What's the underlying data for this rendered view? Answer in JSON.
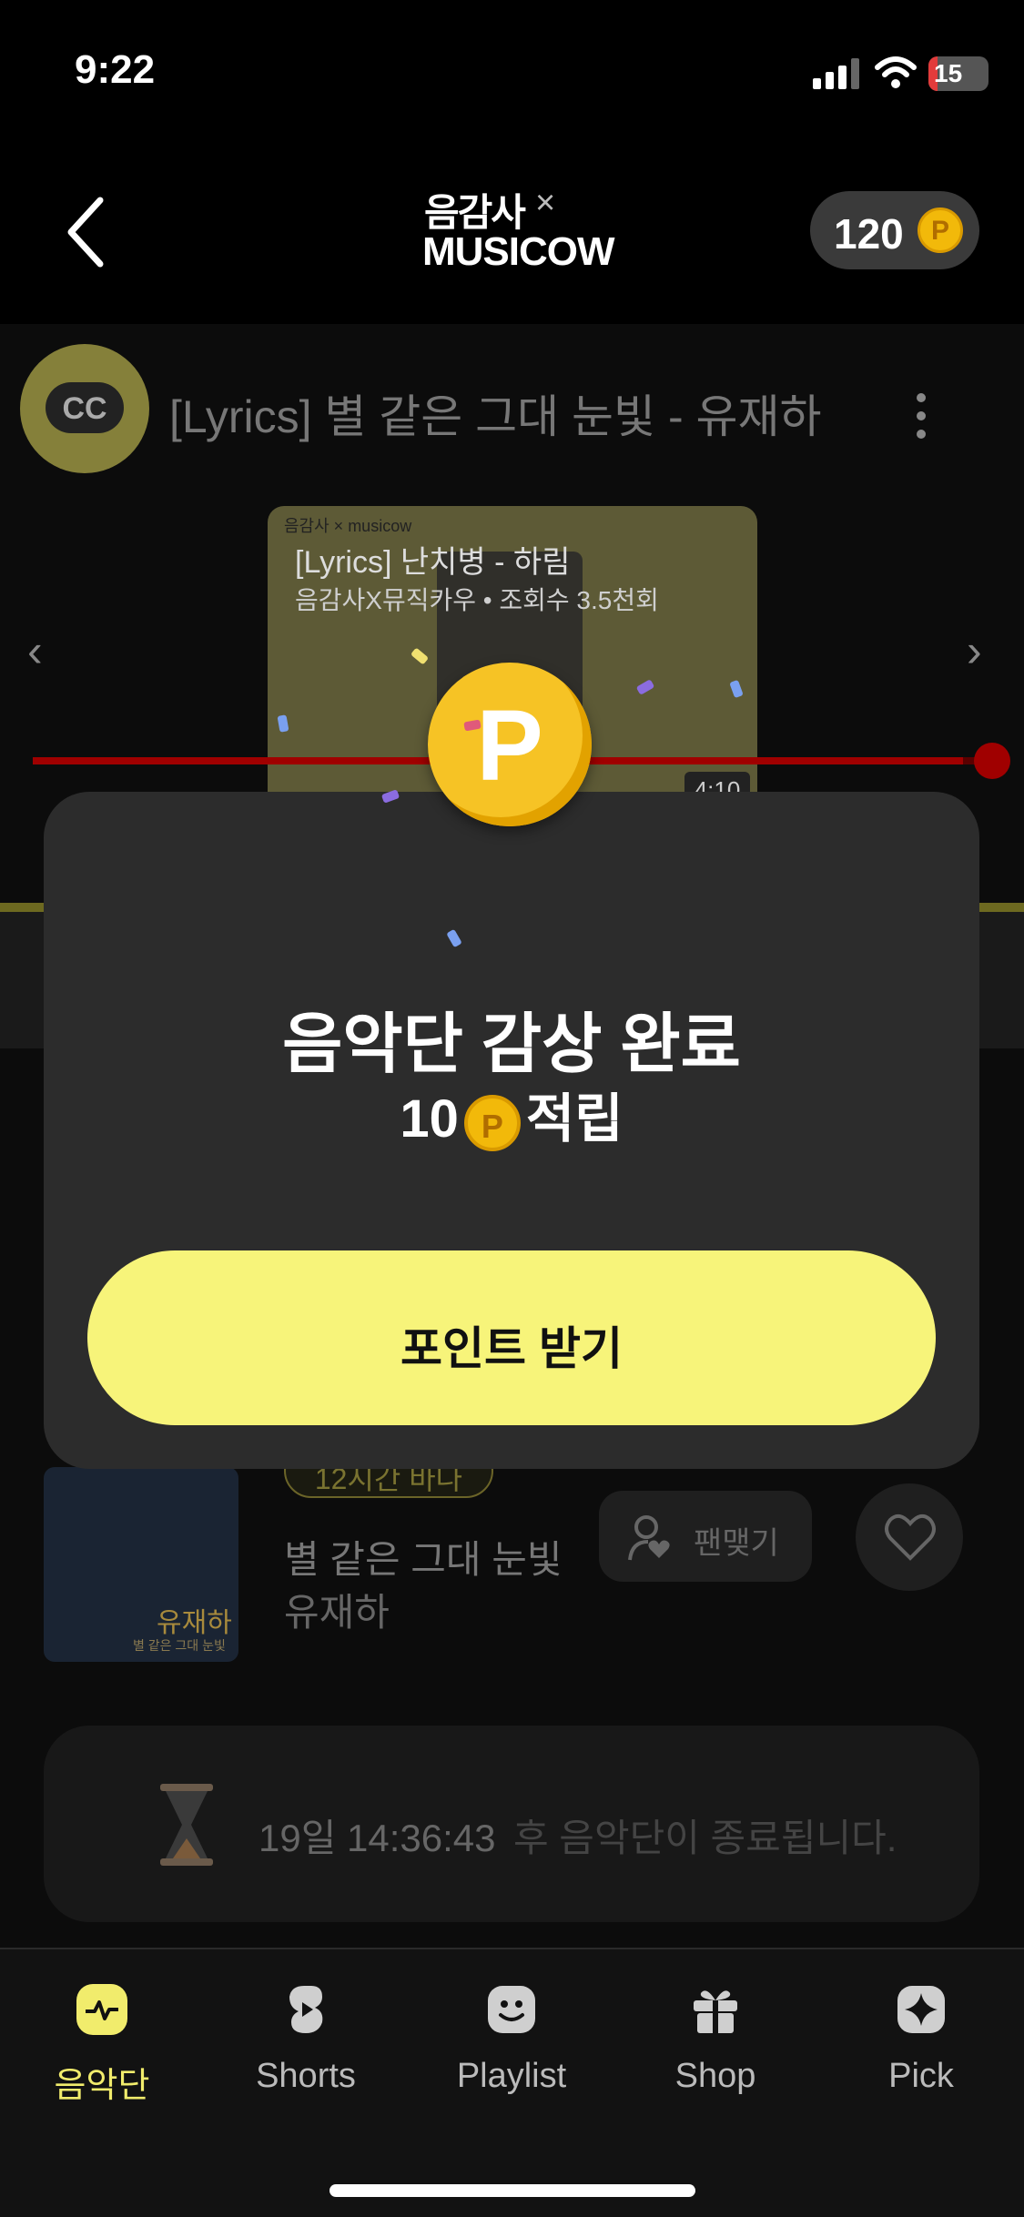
{
  "status_bar": {
    "time": "9:22",
    "battery": "15",
    "battery_level": 0.15
  },
  "header": {
    "logo_top": "음감사",
    "logo_x": "×",
    "logo_bottom": "MUSICOW",
    "points": "120",
    "point_symbol": "P"
  },
  "video": {
    "channel_avatar": "CC",
    "title": "[Lyrics] 별 같은 그대 눈빛 - 유재하",
    "next_card": {
      "title": "[Lyrics] 난치병 - 하림",
      "subtitle": "음감사X뮤직카우 • 조회수 3.5천회",
      "duration": "4:10",
      "card_logo": "음감사 × musicow"
    },
    "progress": 0.97
  },
  "track": {
    "tag": "12시간 바나",
    "album_text": "유재하",
    "album_subtext": "별 같은 그대 눈빛",
    "song": "별 같은 그대 눈빛",
    "artist": "유재하",
    "fan_button": "팬맺기"
  },
  "timer": {
    "time": "19일 14:36:43",
    "text": "후 음악단이 종료됩니다."
  },
  "modal": {
    "title": "음악단 감상 완료",
    "reward_amount": "10",
    "reward_symbol": "P",
    "reward_suffix": "적립",
    "button": "포인트 받기"
  },
  "tabs": [
    {
      "label": "음악단",
      "icon": "pulse-icon",
      "active": true
    },
    {
      "label": "Shorts",
      "icon": "shorts-icon",
      "active": false
    },
    {
      "label": "Playlist",
      "icon": "smile-icon",
      "active": false
    },
    {
      "label": "Shop",
      "icon": "gift-icon",
      "active": false
    },
    {
      "label": "Pick",
      "icon": "sparkle-icon",
      "active": false
    }
  ],
  "colors": {
    "accent": "#f7f47a",
    "active_tab": "#f1ec6c",
    "coin": "#f2b90a",
    "progress": "#a00000"
  }
}
